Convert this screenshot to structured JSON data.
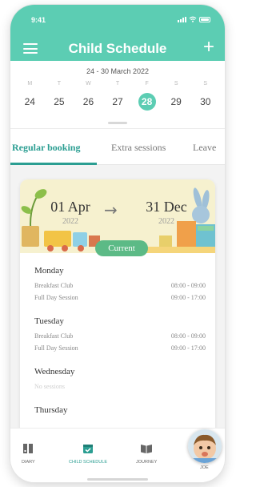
{
  "status_bar": {
    "time": "9:41"
  },
  "header": {
    "title": "Child Schedule"
  },
  "week": {
    "range": "24 - 30 March 2022",
    "letters": [
      "M",
      "T",
      "W",
      "T",
      "F",
      "S",
      "S"
    ],
    "days": [
      "24",
      "25",
      "26",
      "27",
      "28",
      "29",
      "30"
    ],
    "selected": "28"
  },
  "tabs": [
    "Regular booking",
    "Extra sessions",
    "Leave"
  ],
  "booking": {
    "from_date": "01 Apr",
    "from_year": "2022",
    "to_date": "31 Dec",
    "to_year": "2022",
    "status": "Current"
  },
  "schedule": [
    {
      "day": "Monday",
      "sessions": [
        {
          "name": "Breakfast Club",
          "time": "08:00 - 09:00"
        },
        {
          "name": "Full Day Session",
          "time": "09:00 - 17:00"
        }
      ]
    },
    {
      "day": "Tuesday",
      "sessions": [
        {
          "name": "Breakfast Club",
          "time": "08:00 - 09:00"
        },
        {
          "name": "Full Day Session",
          "time": "09:00 - 17:00"
        }
      ]
    },
    {
      "day": "Wednesday",
      "no_sessions": "No sessions"
    },
    {
      "day": "Thursday"
    }
  ],
  "bottom_nav": [
    {
      "label": "DIARY",
      "icon": "diary-icon"
    },
    {
      "label": "CHILD SCHEDULE",
      "icon": "calendar-check-icon",
      "active": true
    },
    {
      "label": "JOURNEY",
      "icon": "book-open-icon"
    },
    {
      "label": "JOE",
      "icon": "child-avatar"
    }
  ],
  "colors": {
    "header": "#5ccdb3",
    "accent": "#2b9e92",
    "pill": "#5cba86",
    "banner": "#f6f1cf"
  }
}
